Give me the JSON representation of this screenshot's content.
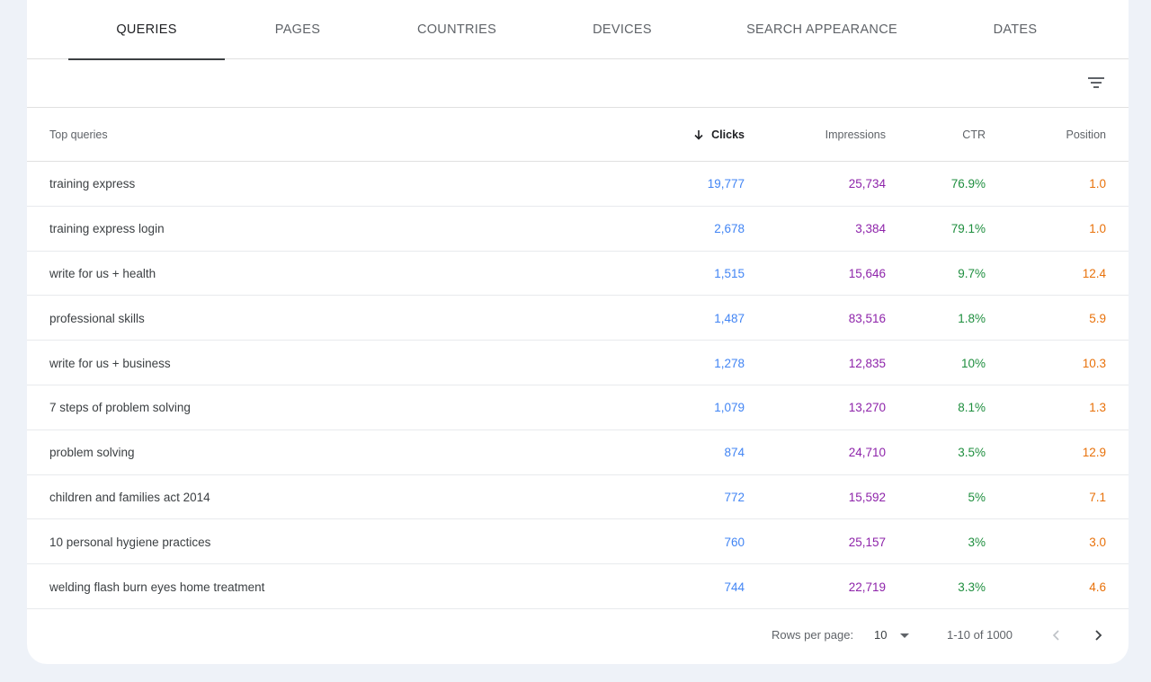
{
  "tabs": [
    {
      "label": "QUERIES",
      "active": true
    },
    {
      "label": "PAGES",
      "active": false
    },
    {
      "label": "COUNTRIES",
      "active": false
    },
    {
      "label": "DEVICES",
      "active": false
    },
    {
      "label": "SEARCH APPEARANCE",
      "active": false
    },
    {
      "label": "DATES",
      "active": false
    }
  ],
  "filter": {
    "icon": "filter-icon"
  },
  "table": {
    "headers": {
      "query": "Top queries",
      "clicks": "Clicks",
      "impressions": "Impressions",
      "ctr": "CTR",
      "position": "Position"
    },
    "sort": {
      "column": "clicks",
      "direction": "desc",
      "icon": "arrow-down-icon"
    },
    "rows": [
      {
        "query": "training express",
        "clicks": "19,777",
        "impressions": "25,734",
        "ctr": "76.9%",
        "position": "1.0"
      },
      {
        "query": "training express login",
        "clicks": "2,678",
        "impressions": "3,384",
        "ctr": "79.1%",
        "position": "1.0"
      },
      {
        "query": "write for us + health",
        "clicks": "1,515",
        "impressions": "15,646",
        "ctr": "9.7%",
        "position": "12.4"
      },
      {
        "query": "professional skills",
        "clicks": "1,487",
        "impressions": "83,516",
        "ctr": "1.8%",
        "position": "5.9"
      },
      {
        "query": "write for us + business",
        "clicks": "1,278",
        "impressions": "12,835",
        "ctr": "10%",
        "position": "10.3"
      },
      {
        "query": "7 steps of problem solving",
        "clicks": "1,079",
        "impressions": "13,270",
        "ctr": "8.1%",
        "position": "1.3"
      },
      {
        "query": "problem solving",
        "clicks": "874",
        "impressions": "24,710",
        "ctr": "3.5%",
        "position": "12.9"
      },
      {
        "query": "children and families act 2014",
        "clicks": "772",
        "impressions": "15,592",
        "ctr": "5%",
        "position": "7.1"
      },
      {
        "query": "10 personal hygiene practices",
        "clicks": "760",
        "impressions": "25,157",
        "ctr": "3%",
        "position": "3.0"
      },
      {
        "query": "welding flash burn eyes home treatment",
        "clicks": "744",
        "impressions": "22,719",
        "ctr": "3.3%",
        "position": "4.6"
      }
    ]
  },
  "pagination": {
    "rows_label": "Rows per page:",
    "rows_value": "10",
    "range": "1-10 of 1000"
  },
  "colors": {
    "clicks": "#4285f4",
    "impressions": "#8e24aa",
    "ctr": "#1e8e3e",
    "position": "#e8710a",
    "background": "#eef2f8"
  }
}
